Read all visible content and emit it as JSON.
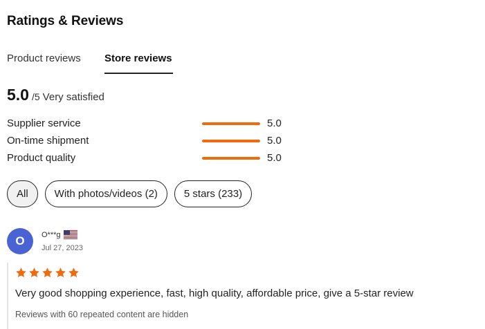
{
  "section_title": "Ratings & Reviews",
  "tabs": [
    {
      "label": "Product reviews",
      "active": false
    },
    {
      "label": "Store reviews",
      "active": true
    }
  ],
  "overall": {
    "score": "5.0",
    "scale": "/5",
    "description": "Very satisfied"
  },
  "metrics": [
    {
      "label": "Supplier service",
      "value": "5.0",
      "fill_percent": 100
    },
    {
      "label": "On-time shipment",
      "value": "5.0",
      "fill_percent": 100
    },
    {
      "label": "Product quality",
      "value": "5.0",
      "fill_percent": 100
    }
  ],
  "filters": [
    {
      "label": "All",
      "active": true
    },
    {
      "label": "With photos/videos (2)",
      "active": false
    },
    {
      "label": "5 stars (233)",
      "active": false
    }
  ],
  "review": {
    "avatar_letter": "O",
    "reviewer": "O***g",
    "country_flag_icon": "us-flag-icon",
    "date": "Jul 27, 2023",
    "stars": 5,
    "text": "Very good shopping experience, fast, high quality, affordable price, give a 5-star review",
    "hidden_note": "Reviews with 60 repeated content are hidden"
  },
  "colors": {
    "accent": "#ee6b0e",
    "avatar": "#4a63d3",
    "text": "#222222"
  }
}
